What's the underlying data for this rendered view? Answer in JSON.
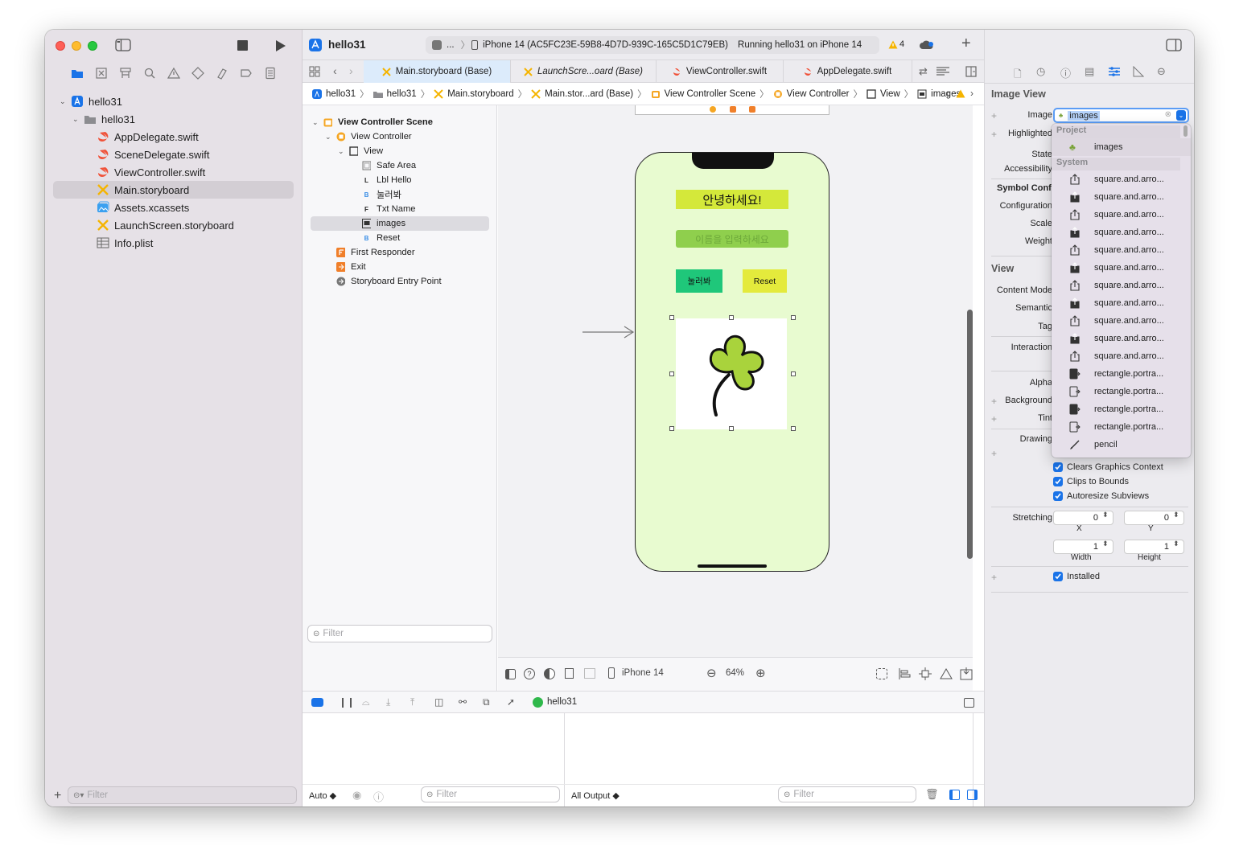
{
  "toolbar": {
    "project_title": "hello31",
    "scheme_short": "...",
    "device": "iPhone 14 (AC5FC23E-59B8-4D7D-939C-165C5D1C79EB)",
    "status": "Running hello31 on iPhone 14",
    "warnings": "4"
  },
  "navigator": {
    "items": [
      {
        "label": "hello31",
        "kind": "project"
      },
      {
        "label": "hello31",
        "kind": "folder"
      },
      {
        "label": "AppDelegate.swift",
        "kind": "swift"
      },
      {
        "label": "SceneDelegate.swift",
        "kind": "swift"
      },
      {
        "label": "ViewController.swift",
        "kind": "swift"
      },
      {
        "label": "Main.storyboard",
        "kind": "storyboard",
        "selected": true
      },
      {
        "label": "Assets.xcassets",
        "kind": "assets"
      },
      {
        "label": "LaunchScreen.storyboard",
        "kind": "storyboard"
      },
      {
        "label": "Info.plist",
        "kind": "plist"
      }
    ],
    "filter_placeholder": "Filter"
  },
  "tabs": [
    {
      "label": "Main.storyboard (Base)",
      "active": true
    },
    {
      "label": "LaunchScre...oard (Base)",
      "italic": true
    },
    {
      "label": "ViewController.swift"
    },
    {
      "label": "AppDelegate.swift"
    }
  ],
  "breadcrumb": [
    "hello31",
    "hello31",
    "Main.storyboard",
    "Main.stor...ard (Base)",
    "View Controller Scene",
    "View Controller",
    "View",
    "images"
  ],
  "outline": {
    "items": [
      {
        "label": "View Controller Scene",
        "indent": 0,
        "icon": "scene",
        "bold": true
      },
      {
        "label": "View Controller",
        "indent": 1,
        "icon": "vc"
      },
      {
        "label": "View",
        "indent": 2,
        "icon": "view"
      },
      {
        "label": "Safe Area",
        "indent": 3,
        "icon": "safe"
      },
      {
        "label": "Lbl Hello",
        "indent": 3,
        "icon": "L"
      },
      {
        "label": "눌러봐",
        "indent": 3,
        "icon": "B"
      },
      {
        "label": "Txt Name",
        "indent": 3,
        "icon": "F"
      },
      {
        "label": "images",
        "indent": 3,
        "icon": "img",
        "selected": true
      },
      {
        "label": "Reset",
        "indent": 3,
        "icon": "B"
      },
      {
        "label": "First Responder",
        "indent": 1,
        "icon": "fr"
      },
      {
        "label": "Exit",
        "indent": 1,
        "icon": "exit"
      },
      {
        "label": "Storyboard Entry Point",
        "indent": 1,
        "icon": "entry"
      }
    ],
    "filter_placeholder": "Filter"
  },
  "phone": {
    "label_text": "안녕하세요!",
    "textfield_placeholder": "이름을 입력하세요",
    "button_press": "눌러봐",
    "button_reset": "Reset"
  },
  "canvas_toolbar": {
    "device": "iPhone 14",
    "zoom": "64%"
  },
  "debug": {
    "target": "hello31",
    "auto": "Auto ◆",
    "output": "All Output ◆",
    "filter_placeholder": "Filter"
  },
  "inspector": {
    "section_image_view": "Image View",
    "image_label": "Image",
    "image_value": "images",
    "highlighted_label": "Highlighted",
    "state_label": "State",
    "accessibility_label": "Accessibility",
    "symbol_config_label": "Symbol Config",
    "configuration_label": "Configuration",
    "scale_label": "Scale",
    "weight_label": "Weight",
    "section_view": "View",
    "content_mode_label": "Content Mode",
    "semantic_label": "Semantic",
    "tag_label": "Tag",
    "interaction_label": "Interaction",
    "alpha_label": "Alpha",
    "background_label": "Background",
    "tint_label": "Tint",
    "drawing_label": "Drawing",
    "clears_graphics": "Clears Graphics Context",
    "clips_bounds": "Clips to Bounds",
    "autoresize": "Autoresize Subviews",
    "stretching_label": "Stretching",
    "stretch_x": "0",
    "stretch_y": "0",
    "stretch_x_label": "X",
    "stretch_y_label": "Y",
    "stretch_w": "1",
    "stretch_h": "1",
    "stretch_w_label": "Width",
    "stretch_h_label": "Height",
    "installed": "Installed"
  },
  "dropdown": {
    "header_project": "Project",
    "project_item": "images",
    "header_system": "System",
    "system_items": [
      "square.and.arro...",
      "square.and.arro...",
      "square.and.arro...",
      "square.and.arro...",
      "square.and.arro...",
      "square.and.arro...",
      "square.and.arro...",
      "square.and.arro...",
      "square.and.arro...",
      "square.and.arro...",
      "square.and.arro...",
      "rectangle.portra...",
      "rectangle.portra...",
      "rectangle.portra...",
      "rectangle.portra...",
      "pencil"
    ]
  },
  "colors": {
    "accent": "#1a73e8",
    "selected_tab": "#dcebfb",
    "phone_bg": "#e8fbd0",
    "label_bg": "#d4e83a",
    "textfield_bg": "#8fcf4d",
    "press_button": "#1fc77a",
    "reset_button": "#e4ea3c"
  }
}
